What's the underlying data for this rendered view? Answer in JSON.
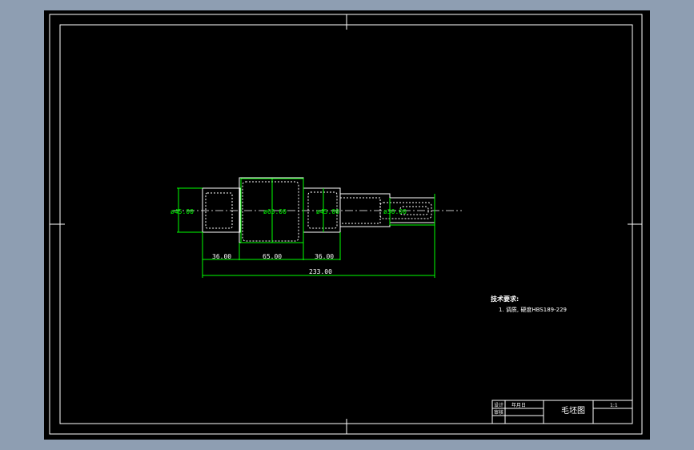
{
  "colors": {
    "app_background": "#8e9eb2",
    "canvas": "#000000",
    "border": "#ffffff",
    "part_outline": "#ffffff",
    "dimension": "#00ff00",
    "text": "#ffffff"
  },
  "drawing": {
    "dims": {
      "dia_left": "ø45.00",
      "dia_center": "ø65.00",
      "dia_right1": "ø45.00",
      "dia_right2": "ø30.00",
      "len1": "36.00",
      "len2": "65.00",
      "len3": "36.00",
      "total": "233.00"
    },
    "notes": {
      "heading": "技术要求:",
      "item1": "1. 调质, 硬度HBS189-229"
    },
    "title_block": {
      "drawn_label": "设计",
      "drawn_value": "年月日",
      "check_label": "审核",
      "title": "毛坯图",
      "scale": "1:1"
    }
  }
}
